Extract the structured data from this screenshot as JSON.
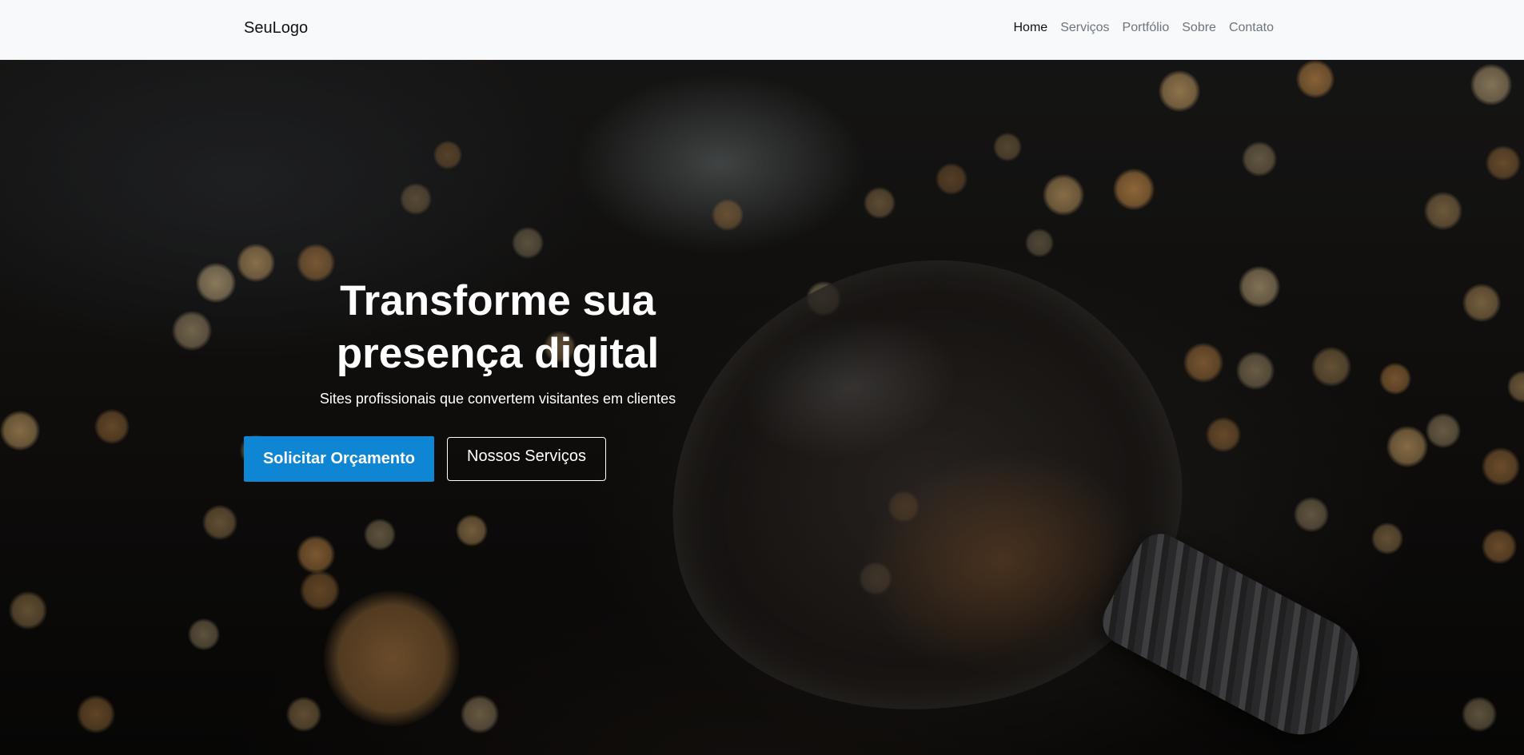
{
  "navbar": {
    "brand": "SeuLogo",
    "links": [
      {
        "label": "Home",
        "active": true
      },
      {
        "label": "Serviços",
        "active": false
      },
      {
        "label": "Portfólio",
        "active": false
      },
      {
        "label": "Sobre",
        "active": false
      },
      {
        "label": "Contato",
        "active": false
      }
    ]
  },
  "hero": {
    "title": "Transforme sua presença digital",
    "subtitle": "Sites profissionais que convertem visitantes em clientes",
    "primary_button": "Solicitar Orçamento",
    "secondary_button": "Nossos Serviços",
    "background_image": "light-bulb-with-bokeh-lights",
    "colors": {
      "primary_button": "#0e86d4",
      "navbar_bg": "#f8f9fa"
    }
  }
}
